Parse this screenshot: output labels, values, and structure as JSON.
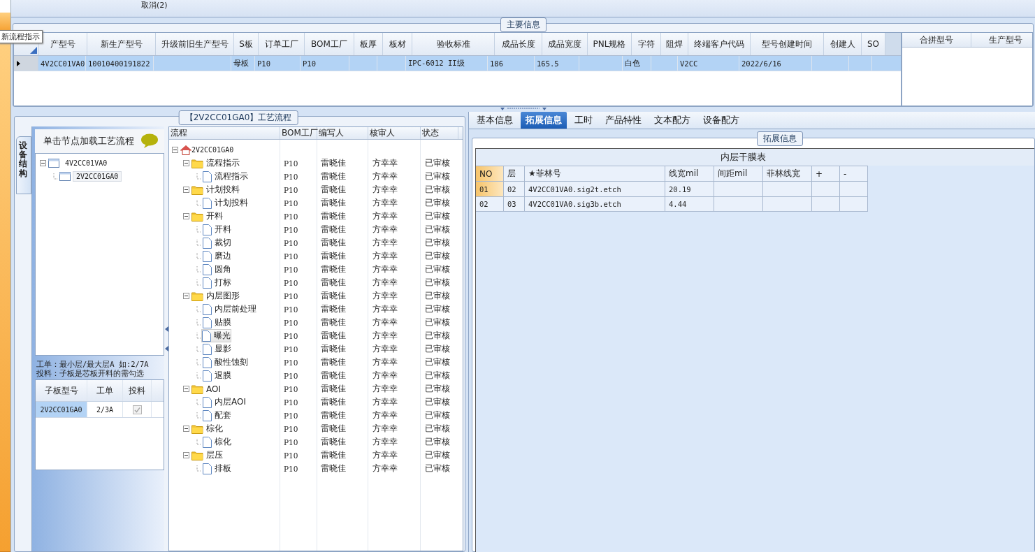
{
  "toolbar": {
    "cut_label": "取消(2)"
  },
  "main_info": {
    "title": "主要信息",
    "tooltip": "新流程指示",
    "columns": [
      "产型号",
      "新生产型号",
      "升级前旧生产型号",
      "S板",
      "订单工厂",
      "BOM工厂",
      "板厚",
      "板材",
      "验收标准",
      "成品长度",
      "成品宽度",
      "PNL规格",
      "字符",
      "阻焊",
      "终端客户代码",
      "型号创建时间",
      "创建人",
      "SO"
    ],
    "rows": [
      {
        "selected": true,
        "cells": [
          "4V2CC01VA0",
          "10010400191822",
          null,
          "母板",
          "P10",
          "P10",
          null,
          null,
          "IPC-6012 II级",
          "186",
          "165.5",
          null,
          "白色",
          null,
          "V2CC",
          "2022/6/16",
          null,
          null
        ]
      }
    ],
    "side_columns": [
      "合拼型号",
      "生产型号"
    ]
  },
  "process": {
    "title": "【2V2CC01GA0】工艺流程",
    "side_tab": "设备结构",
    "hint": "单击节点加载工艺流程",
    "structure_tree": [
      {
        "label": "4V2CC01VA0",
        "expanded": true,
        "selected": false,
        "children": [
          {
            "label": "2V2CC01GA0",
            "selected": true
          }
        ]
      }
    ],
    "notes": [
      "工单：最小层/最大层A 如:2/7A",
      "投料：子板是芯板开料的需勾选"
    ],
    "sub_columns": [
      "子板型号",
      "工单",
      "投料"
    ],
    "sub_rows": [
      {
        "board": "2V2CC01GA0",
        "order": "2/3A",
        "feed_checked": true,
        "selected": true
      }
    ],
    "flow_columns": [
      "流程",
      "BOM工厂",
      "编写人",
      "核审人",
      "状态"
    ],
    "flow_tree": [
      {
        "kind": "root",
        "label": "2V2CC01GA0",
        "expanded": true,
        "selected": false,
        "children": [
          {
            "kind": "group",
            "label": "流程指示",
            "expanded": true,
            "selected": false,
            "bom": "P10",
            "writer": "雷晓佳",
            "reviewer": "方幸幸",
            "status": "已审核",
            "children": [
              {
                "kind": "step",
                "label": "流程指示",
                "selected": false,
                "bom": "P10",
                "writer": "雷晓佳",
                "reviewer": "方幸幸",
                "status": "已审核"
              }
            ]
          },
          {
            "kind": "group",
            "label": "计划投料",
            "expanded": true,
            "selected": false,
            "bom": "P10",
            "writer": "雷晓佳",
            "reviewer": "方幸幸",
            "status": "已审核",
            "children": [
              {
                "kind": "step",
                "label": "计划投料",
                "selected": false,
                "bom": "P10",
                "writer": "雷晓佳",
                "reviewer": "方幸幸",
                "status": "已审核"
              }
            ]
          },
          {
            "kind": "group",
            "label": "开料",
            "expanded": true,
            "selected": false,
            "bom": "P10",
            "writer": "雷晓佳",
            "reviewer": "方幸幸",
            "status": "已审核",
            "children": [
              {
                "kind": "step",
                "label": "开料",
                "selected": false,
                "bom": "P10",
                "writer": "雷晓佳",
                "reviewer": "方幸幸",
                "status": "已审核"
              },
              {
                "kind": "step",
                "label": "裁切",
                "selected": false,
                "bom": "P10",
                "writer": "雷晓佳",
                "reviewer": "方幸幸",
                "status": "已审核"
              },
              {
                "kind": "step",
                "label": "磨边",
                "selected": false,
                "bom": "P10",
                "writer": "雷晓佳",
                "reviewer": "方幸幸",
                "status": "已审核"
              },
              {
                "kind": "step",
                "label": "圆角",
                "selected": false,
                "bom": "P10",
                "writer": "雷晓佳",
                "reviewer": "方幸幸",
                "status": "已审核"
              },
              {
                "kind": "step",
                "label": "打标",
                "selected": false,
                "bom": "P10",
                "writer": "雷晓佳",
                "reviewer": "方幸幸",
                "status": "已审核"
              }
            ]
          },
          {
            "kind": "group",
            "label": "内层图形",
            "expanded": true,
            "selected": false,
            "bom": "P10",
            "writer": "雷晓佳",
            "reviewer": "方幸幸",
            "status": "已审核",
            "children": [
              {
                "kind": "step",
                "label": "内层前处理",
                "selected": false,
                "bom": "P10",
                "writer": "雷晓佳",
                "reviewer": "方幸幸",
                "status": "已审核"
              },
              {
                "kind": "step",
                "label": "贴膜",
                "selected": false,
                "bom": "P10",
                "writer": "雷晓佳",
                "reviewer": "方幸幸",
                "status": "已审核"
              },
              {
                "kind": "step",
                "label": "曝光",
                "selected": true,
                "bom": "P10",
                "writer": "雷晓佳",
                "reviewer": "方幸幸",
                "status": "已审核"
              },
              {
                "kind": "step",
                "label": "显影",
                "selected": false,
                "bom": "P10",
                "writer": "雷晓佳",
                "reviewer": "方幸幸",
                "status": "已审核"
              },
              {
                "kind": "step",
                "label": "酸性蚀刻",
                "selected": false,
                "bom": "P10",
                "writer": "雷晓佳",
                "reviewer": "方幸幸",
                "status": "已审核"
              },
              {
                "kind": "step",
                "label": "退膜",
                "selected": false,
                "bom": "P10",
                "writer": "雷晓佳",
                "reviewer": "方幸幸",
                "status": "已审核"
              }
            ]
          },
          {
            "kind": "group",
            "label": "AOI",
            "expanded": true,
            "selected": false,
            "bom": "P10",
            "writer": "雷晓佳",
            "reviewer": "方幸幸",
            "status": "已审核",
            "children": [
              {
                "kind": "step",
                "label": "内层AOI",
                "selected": false,
                "bom": "P10",
                "writer": "雷晓佳",
                "reviewer": "方幸幸",
                "status": "已审核"
              },
              {
                "kind": "step",
                "label": "配套",
                "selected": false,
                "bom": "P10",
                "writer": "雷晓佳",
                "reviewer": "方幸幸",
                "status": "已审核"
              }
            ]
          },
          {
            "kind": "group",
            "label": "棕化",
            "expanded": true,
            "selected": false,
            "bom": "P10",
            "writer": "雷晓佳",
            "reviewer": "方幸幸",
            "status": "已审核",
            "children": [
              {
                "kind": "step",
                "label": "棕化",
                "selected": false,
                "bom": "P10",
                "writer": "雷晓佳",
                "reviewer": "方幸幸",
                "status": "已审核"
              }
            ]
          },
          {
            "kind": "group",
            "label": "层压",
            "expanded": true,
            "selected": false,
            "bom": "P10",
            "writer": "雷晓佳",
            "reviewer": "方幸幸",
            "status": "已审核",
            "children": [
              {
                "kind": "step",
                "label": "排板",
                "selected": false,
                "bom": "P10",
                "writer": "雷晓佳",
                "reviewer": "方幸幸",
                "status": "已审核"
              }
            ]
          }
        ]
      }
    ]
  },
  "details": {
    "tabs": [
      {
        "label": "基本信息",
        "selected": false
      },
      {
        "label": "拓展信息",
        "selected": true
      },
      {
        "label": "工时",
        "selected": false
      },
      {
        "label": "产品特性",
        "selected": false
      },
      {
        "label": "文本配方",
        "selected": false
      },
      {
        "label": "设备配方",
        "selected": false
      }
    ],
    "group_title": "拓展信息",
    "table_title": "内层干膜表",
    "columns": [
      "NO",
      "层",
      "★菲林号",
      "线宽mil",
      "间距mil",
      "菲林线宽",
      "+",
      "-"
    ],
    "rows": [
      {
        "selected": true,
        "cells": [
          "01",
          "02",
          "4V2CC01VA0.sig2t.etch",
          "20.19",
          null,
          null,
          null,
          null
        ]
      },
      {
        "selected": false,
        "cells": [
          "02",
          "03",
          "4V2CC01VA0.sig3b.etch",
          "4.44",
          null,
          null,
          null,
          null
        ]
      }
    ]
  }
}
